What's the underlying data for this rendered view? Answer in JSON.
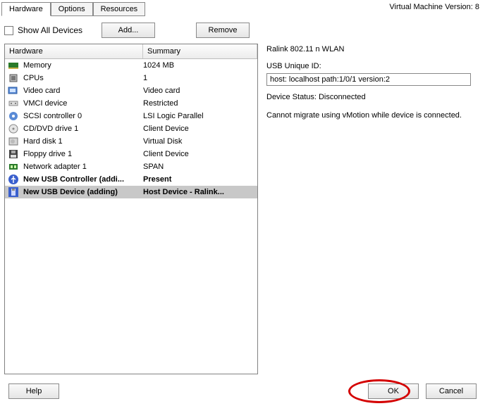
{
  "vm_version": "Virtual Machine Version: 8",
  "tabs": {
    "hardware": "Hardware",
    "options": "Options",
    "resources": "Resources"
  },
  "show_all": "Show All Devices",
  "buttons": {
    "add": "Add...",
    "remove": "Remove",
    "help": "Help",
    "ok": "OK",
    "cancel": "Cancel"
  },
  "headers": {
    "hardware": "Hardware",
    "summary": "Summary"
  },
  "rows": [
    {
      "icon": "memory-icon",
      "name": "Memory",
      "summary": "1024 MB",
      "bold": false,
      "sel": false
    },
    {
      "icon": "cpu-icon",
      "name": "CPUs",
      "summary": "1",
      "bold": false,
      "sel": false
    },
    {
      "icon": "video-icon",
      "name": "Video card",
      "summary": "Video card",
      "bold": false,
      "sel": false
    },
    {
      "icon": "vmci-icon",
      "name": "VMCI device",
      "summary": "Restricted",
      "bold": false,
      "sel": false
    },
    {
      "icon": "scsi-icon",
      "name": "SCSI controller 0",
      "summary": "LSI Logic Parallel",
      "bold": false,
      "sel": false
    },
    {
      "icon": "cd-icon",
      "name": "CD/DVD drive 1",
      "summary": "Client Device",
      "bold": false,
      "sel": false
    },
    {
      "icon": "disk-icon",
      "name": "Hard disk 1",
      "summary": "Virtual Disk",
      "bold": false,
      "sel": false
    },
    {
      "icon": "floppy-icon",
      "name": "Floppy drive 1",
      "summary": "Client Device",
      "bold": false,
      "sel": false
    },
    {
      "icon": "nic-icon",
      "name": "Network adapter 1",
      "summary": "SPAN",
      "bold": false,
      "sel": false
    },
    {
      "icon": "usb-ctrl-icon",
      "name": "New USB Controller (addi...",
      "summary": "Present",
      "bold": true,
      "sel": false
    },
    {
      "icon": "usb-dev-icon",
      "name": "New USB Device (adding)",
      "summary": "Host Device - Ralink...",
      "bold": true,
      "sel": true
    }
  ],
  "right": {
    "title": "Ralink 802.11 n WLAN",
    "usb_id_label": "USB Unique ID:",
    "usb_id_value": "host: localhost path:1/0/1 version:2",
    "status": "Device Status: Disconnected",
    "migrate": "Cannot migrate using vMotion while device is connected."
  }
}
